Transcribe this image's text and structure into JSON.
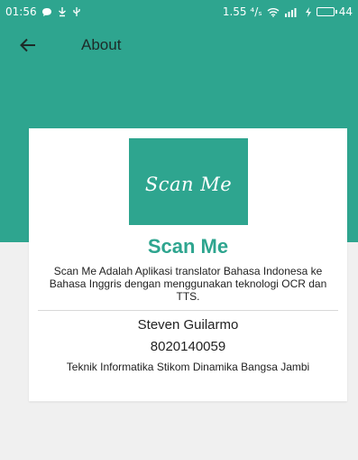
{
  "status_bar": {
    "time": "01:56",
    "speed": "1.55 ⁴/ₛ",
    "battery": "44"
  },
  "toolbar": {
    "title": "About"
  },
  "about": {
    "logo_text": "Scan Me",
    "app_name": "Scan Me",
    "description": "Scan Me Adalah Aplikasi translator Bahasa Indonesa ke Bahasa Inggris dengan menggunakan teknologi OCR dan TTS.",
    "author_name": "Steven Guilarmo",
    "student_id": "8020140059",
    "institution": "Teknik Informatika Stikom Dinamika Bangsa Jambi"
  },
  "colors": {
    "primary": "#2ea58f",
    "background": "#f0f0f0"
  }
}
